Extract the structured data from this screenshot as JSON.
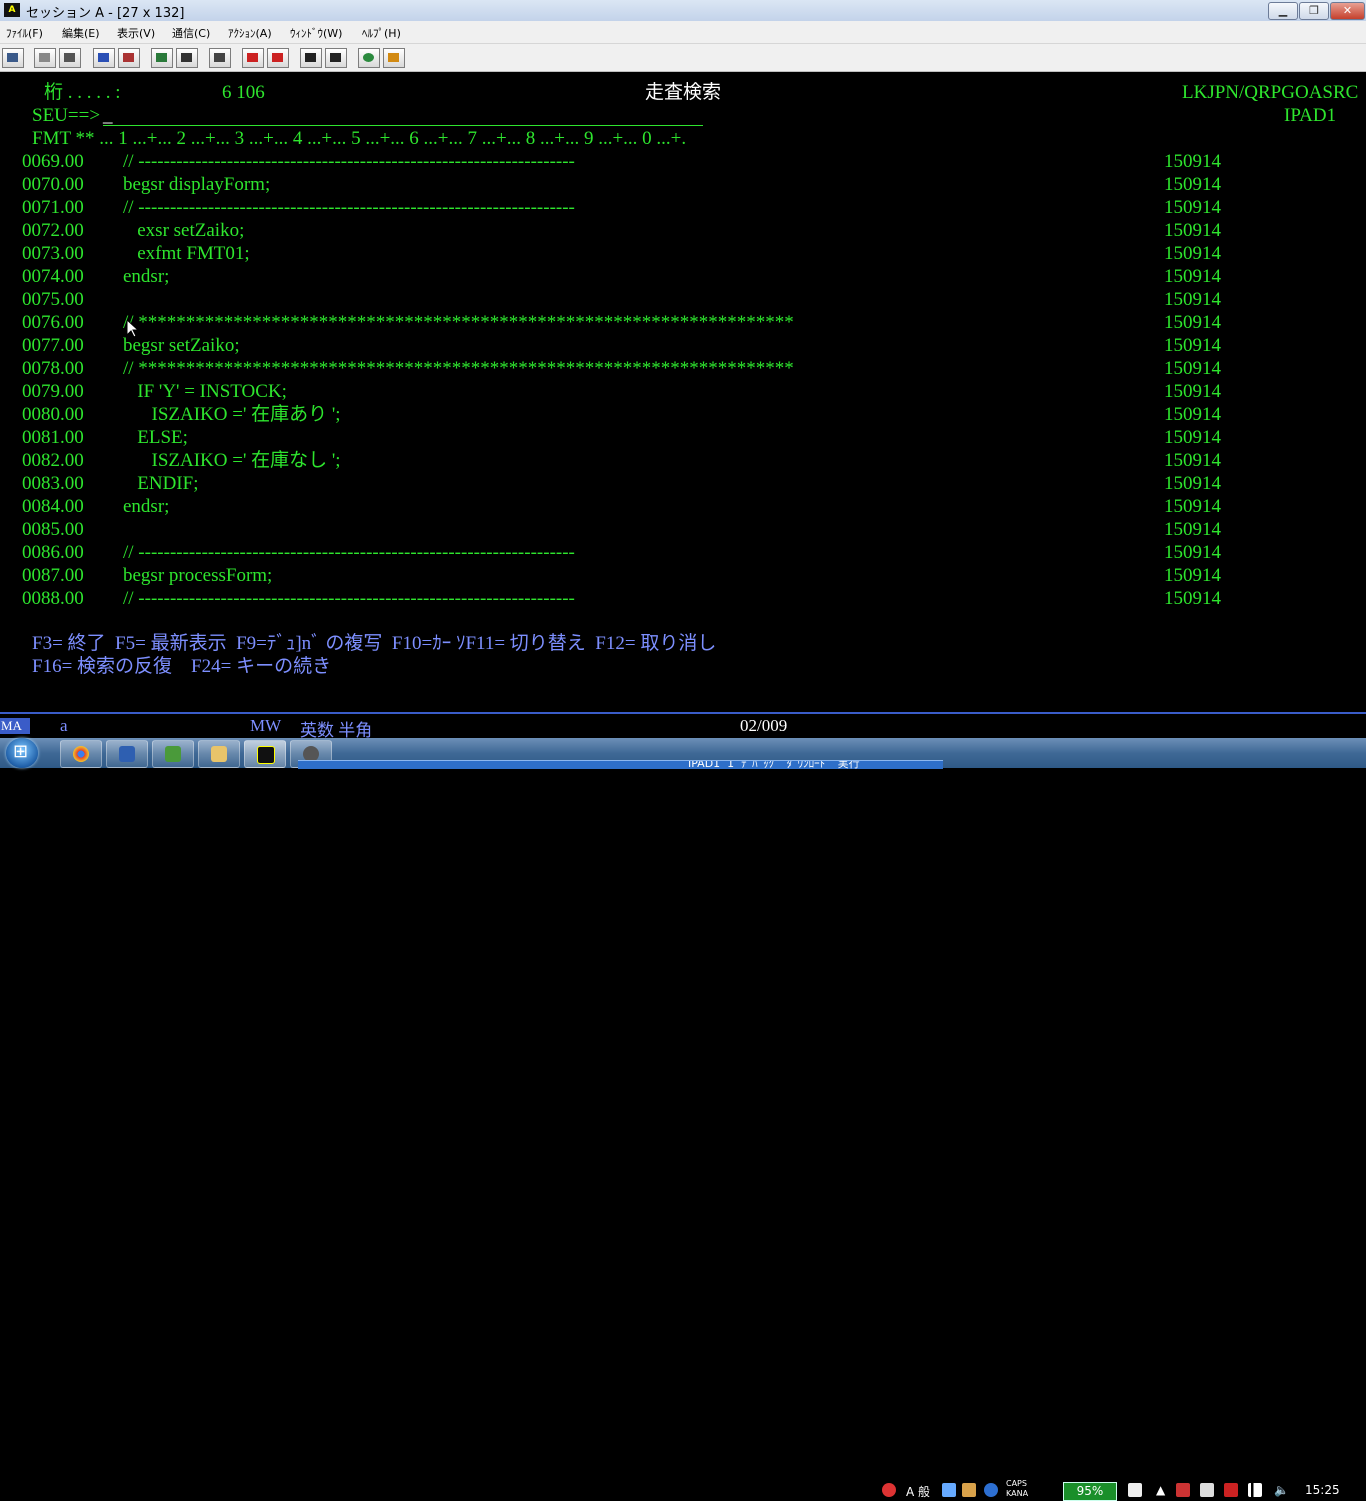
{
  "window": {
    "icon_text": "A",
    "title": "セッション A - [27 x 132]",
    "min_label": "▁",
    "max_label": "❐",
    "close_label": "✕"
  },
  "menu": [
    "ﾌｧｲﾙ(F)",
    "編集(E)",
    "表示(V)",
    "通信(C)",
    "ｱｸｼｮﾝ(A)",
    "ｳｨﾝﾄﾞｳ(W)",
    "ﾍﾙﾌﾟ(H)"
  ],
  "screen": {
    "column_label": "桁 . . . . . :",
    "column_value": "6 106",
    "screen_title": "走査検索",
    "source_name": "LKJPN/QRPGOASRC",
    "member_name": "IPAD1",
    "seu_prompt": "SEU==>",
    "seu_input": "_",
    "fmt_ruler": "FMT ** ... 1 ...+... 2 ...+... 3 ...+... 4 ...+... 5 ...+... 6 ...+... 7 ...+... 8 ...+... 9 ...+... 0 ...+.",
    "lines": [
      {
        "seq": "0069.00",
        "code": "// ---------------------------------------------------------------------",
        "date": "150914"
      },
      {
        "seq": "0070.00",
        "code": "begsr displayForm;",
        "date": "150914"
      },
      {
        "seq": "0071.00",
        "code": "// ---------------------------------------------------------------------",
        "date": "150914"
      },
      {
        "seq": "0072.00",
        "code": "   exsr setZaiko;",
        "date": "150914"
      },
      {
        "seq": "0073.00",
        "code": "   exfmt FMT01;",
        "date": "150914"
      },
      {
        "seq": "0074.00",
        "code": "endsr;",
        "date": "150914"
      },
      {
        "seq": "0075.00",
        "code": "",
        "date": "150914"
      },
      {
        "seq": "0076.00",
        "code": "// *********************************************************************",
        "date": "150914"
      },
      {
        "seq": "0077.00",
        "code": "begsr setZaiko;",
        "date": "150914"
      },
      {
        "seq": "0078.00",
        "code": "// *********************************************************************",
        "date": "150914"
      },
      {
        "seq": "0079.00",
        "code": "   IF 'Y' = INSTOCK;",
        "date": "150914"
      },
      {
        "seq": "0080.00",
        "code": "      ISZAIKO =' 在庫あり ';",
        "date": "150914"
      },
      {
        "seq": "0081.00",
        "code": "   ELSE;",
        "date": "150914"
      },
      {
        "seq": "0082.00",
        "code": "      ISZAIKO =' 在庫なし ';",
        "date": "150914"
      },
      {
        "seq": "0083.00",
        "code": "   ENDIF;",
        "date": "150914"
      },
      {
        "seq": "0084.00",
        "code": "endsr;",
        "date": "150914"
      },
      {
        "seq": "0085.00",
        "code": "",
        "date": "150914"
      },
      {
        "seq": "0086.00",
        "code": "// ---------------------------------------------------------------------",
        "date": "150914"
      },
      {
        "seq": "0087.00",
        "code": "begsr processForm;",
        "date": "150914"
      },
      {
        "seq": "0088.00",
        "code": "// ---------------------------------------------------------------------",
        "date": "150914"
      }
    ],
    "fkeys_line1": "F3= 終了  F5= 最新表示  F9=ﾃﾞｭ]nﾞ の複写  F10=ｶｰ ｿF11= 切り替え  F12= 取り消し",
    "fkeys_line2": "F16= 検索の反復    F24= キーの続き"
  },
  "oia": {
    "ma": "MA",
    "a": "a",
    "mw": "MW",
    "input_mode": "英数 半角",
    "cursor_pos": "02/009"
  },
  "taskbar": {
    "popup_text": "IPAD1  1  ﾃﾞﾊﾞｯｸﾞ  ﾀﾞｳﾝﾛｰﾄﾞ  実行",
    "tray_a": "A 般",
    "caps": "CAPS",
    "kana": "KANA",
    "battery": "95%",
    "time": "15:25"
  }
}
